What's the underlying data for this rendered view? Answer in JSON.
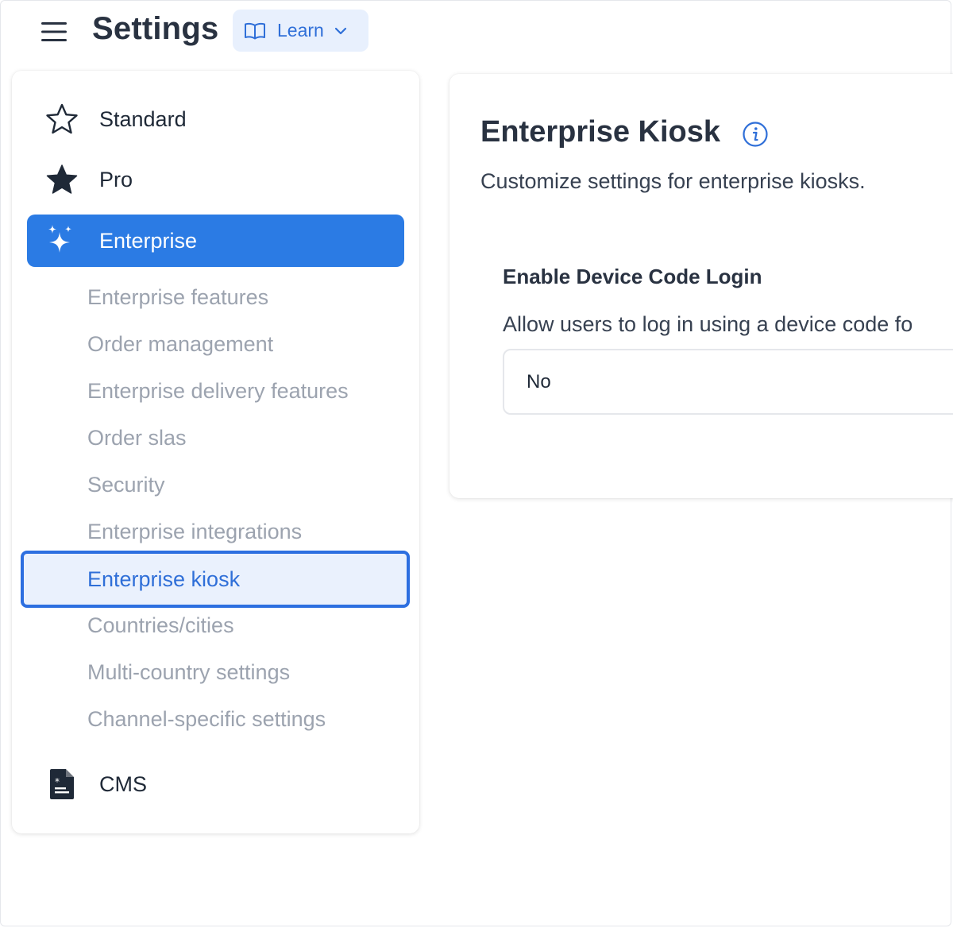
{
  "header": {
    "title": "Settings",
    "learn_label": "Learn"
  },
  "sidebar": {
    "items": [
      {
        "label": "Standard",
        "icon": "star-outline-icon"
      },
      {
        "label": "Pro",
        "icon": "star-filled-icon"
      },
      {
        "label": "Enterprise",
        "icon": "sparkles-icon",
        "active": true
      },
      {
        "label": "CMS",
        "icon": "document-icon"
      }
    ],
    "enterprise_sub": [
      "Enterprise features",
      "Order management",
      "Enterprise delivery features",
      "Order slas",
      "Security",
      "Enterprise integrations",
      "Enterprise kiosk",
      "Countries/cities",
      "Multi-country settings",
      "Channel-specific settings"
    ],
    "selected_sub": "Enterprise kiosk"
  },
  "main": {
    "title": "Enterprise Kiosk",
    "description": "Customize settings for enterprise kiosks.",
    "field": {
      "label": "Enable Device Code Login",
      "help": "Allow users to log in using a device code fo",
      "value": "No"
    }
  },
  "colors": {
    "accent": "#2b7be4",
    "selected_bg": "#eaf1fd",
    "muted_text": "#9ca3af"
  }
}
